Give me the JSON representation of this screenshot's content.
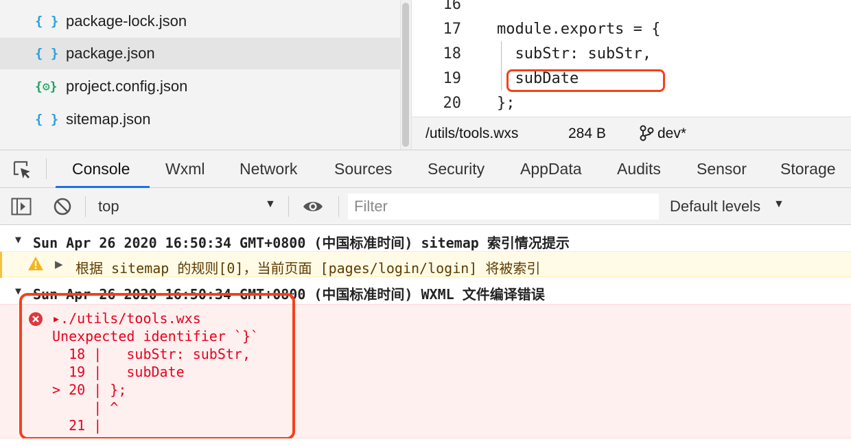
{
  "file_tree": {
    "items": [
      {
        "icon": "{ }",
        "icon_name": "json-icon",
        "label": "package-lock.json",
        "selected": false
      },
      {
        "icon": "{ }",
        "icon_name": "json-icon",
        "label": "package.json",
        "selected": true
      },
      {
        "icon": "{⚙}",
        "icon_name": "config-json-icon",
        "label": "project.config.json",
        "selected": false
      },
      {
        "icon": "{ }",
        "icon_name": "json-icon",
        "label": "sitemap.json",
        "selected": false
      }
    ]
  },
  "editor": {
    "lines": [
      {
        "no": "16",
        "text": ""
      },
      {
        "no": "17",
        "text": "module.exports = {"
      },
      {
        "no": "18",
        "text": "  subStr: subStr,"
      },
      {
        "no": "19",
        "text": "  subDate"
      },
      {
        "no": "20",
        "text": "};"
      }
    ]
  },
  "statusbar": {
    "file_path": "/utils/tools.wxs",
    "file_size": "284 B",
    "branch": "dev*"
  },
  "devtools": {
    "tabs": [
      "Console",
      "Wxml",
      "Network",
      "Sources",
      "Security",
      "AppData",
      "Audits",
      "Sensor",
      "Storage"
    ],
    "active_tab": "Console",
    "context": "top",
    "filter_placeholder": "Filter",
    "levels": "Default levels"
  },
  "console": {
    "group1_header": "Sun Apr 26 2020 16:50:34 GMT+0800 (中国标准时间) sitemap 索引情况提示",
    "warning_text": "根据 sitemap 的规则[0]，当前页面 [pages/login/login] 将被索引",
    "group2_header": "Sun Apr 26 2020 16:50:34 GMT+0800 (中国标准时间)  WXML 文件编译错误",
    "error_lines": [
      "▸./utils/tools.wxs",
      "Unexpected identifier `}`",
      "  18 |   subStr: subStr,",
      "  19 |   subDate",
      "> 20 | };",
      "     | ^",
      "  21 |"
    ]
  },
  "colors": {
    "accent": "#1a73e8",
    "annotation_red": "#f4401c",
    "error_text": "#e8001c",
    "json_icon": "#2aa0dc",
    "config_icon": "#18a25f"
  }
}
